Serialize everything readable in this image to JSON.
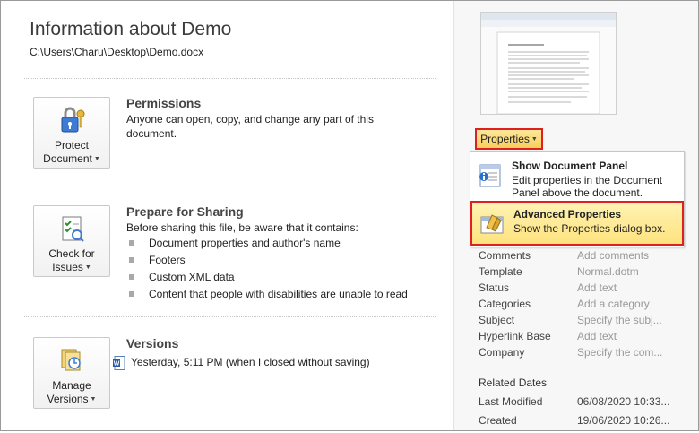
{
  "info": {
    "title": "Information about Demo",
    "path": "C:\\Users\\Charu\\Desktop\\Demo.docx"
  },
  "permissions": {
    "button_line1": "Protect",
    "button_line2": "Document",
    "heading": "Permissions",
    "text": "Anyone can open, copy, and change any part of this document."
  },
  "sharing": {
    "button_line1": "Check for",
    "button_line2": "Issues",
    "heading": "Prepare for Sharing",
    "intro": "Before sharing this file, be aware that it contains:",
    "items": [
      "Document properties and author's name",
      "Footers",
      "Custom XML data",
      "Content that people with disabilities are unable to read"
    ]
  },
  "versions": {
    "button_line1": "Manage",
    "button_line2": "Versions",
    "heading": "Versions",
    "entry": "Yesterday, 5:11 PM (when I closed without saving)"
  },
  "properties_button": "Properties",
  "menu": {
    "items": [
      {
        "title": "Show Document Panel",
        "desc": "Edit properties in the Document Panel above the document."
      },
      {
        "title": "Advanced Properties",
        "desc": "Show the Properties dialog box."
      }
    ]
  },
  "props": [
    {
      "name": "Comments",
      "value": "Add comments"
    },
    {
      "name": "Template",
      "value": "Normal.dotm"
    },
    {
      "name": "Status",
      "value": "Add text"
    },
    {
      "name": "Categories",
      "value": "Add a category"
    },
    {
      "name": "Subject",
      "value": "Specify the subj..."
    },
    {
      "name": "Hyperlink Base",
      "value": "Add text"
    },
    {
      "name": "Company",
      "value": "Specify the com..."
    }
  ],
  "related_dates": {
    "heading": "Related Dates",
    "rows": [
      {
        "name": "Last Modified",
        "value": "06/08/2020 10:33..."
      },
      {
        "name": "Created",
        "value": "19/06/2020 10:26..."
      }
    ]
  },
  "colors": {
    "highlight_border": "#e02020",
    "button_gold": "#f8cf5b",
    "menu_highlight": "#fde27e"
  }
}
